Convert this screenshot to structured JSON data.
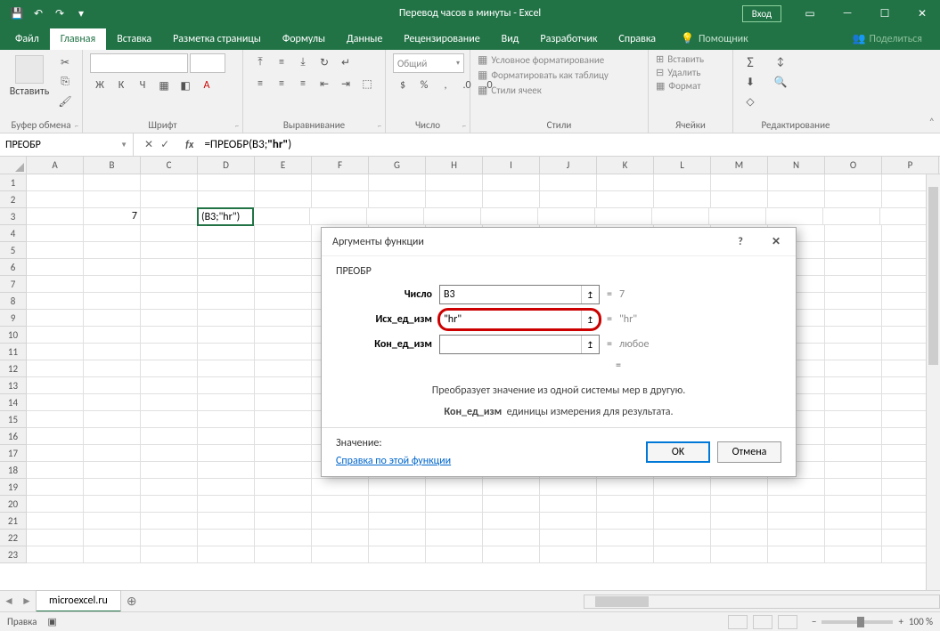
{
  "titlebar": {
    "title": "Перевод часов в минуты  -  Excel",
    "login": "Вход"
  },
  "tabs": {
    "file": "Файл",
    "home": "Главная",
    "insert": "Вставка",
    "layout": "Разметка страницы",
    "formulas": "Формулы",
    "data": "Данные",
    "review": "Рецензирование",
    "view": "Вид",
    "developer": "Разработчик",
    "help": "Справка",
    "tellme": "Помощник",
    "share": "Поделиться"
  },
  "ribbon": {
    "paste": "Вставить",
    "clipboard": "Буфер обмена",
    "font": "Шрифт",
    "alignment": "Выравнивание",
    "number_label": "Число",
    "number_format": "Общий",
    "styles": "Стили",
    "cond_format": "Условное форматирование",
    "format_table": "Форматировать как таблицу",
    "cell_styles": "Стили ячеек",
    "cells": "Ячейки",
    "insert_cells": "Вставить",
    "delete_cells": "Удалить",
    "format_cells": "Формат",
    "editing": "Редактирование",
    "font_letters": {
      "b": "Ж",
      "i": "К",
      "u": "Ч"
    }
  },
  "formula_bar": {
    "name": "ПРЕОБР",
    "formula_prefix": "=ПРЕОБР(B3;",
    "formula_bold": "\"hr\"",
    "formula_suffix": ")"
  },
  "grid": {
    "columns": [
      "A",
      "B",
      "C",
      "D",
      "E",
      "F",
      "G",
      "H",
      "I",
      "J",
      "K",
      "L",
      "M",
      "N",
      "O",
      "P"
    ],
    "row_count": 23,
    "b3": "7",
    "d3": "(B3;\"hr\")"
  },
  "dialog": {
    "title": "Аргументы функции",
    "func_name": "ПРЕОБР",
    "args": [
      {
        "label": "Число",
        "value": "B3",
        "result": "7",
        "bold": true
      },
      {
        "label": "Исх_ед_изм",
        "value": "\"hr\"",
        "result": "\"hr\"",
        "bold": true,
        "highlight": true
      },
      {
        "label": "Кон_ед_изм",
        "value": "",
        "result": "любое",
        "bold": true
      }
    ],
    "eq_blank": "=",
    "desc1": "Преобразует значение из одной системы мер в другую.",
    "desc2_label": "Кон_ед_изм",
    "desc2_text": "единицы измерения для результата.",
    "value_label": "Значение:",
    "help_link": "Справка по этой функции",
    "ok": "OK",
    "cancel": "Отмена"
  },
  "sheet": {
    "name": "microexcel.ru"
  },
  "status": {
    "mode": "Правка",
    "zoom": "100 %"
  }
}
